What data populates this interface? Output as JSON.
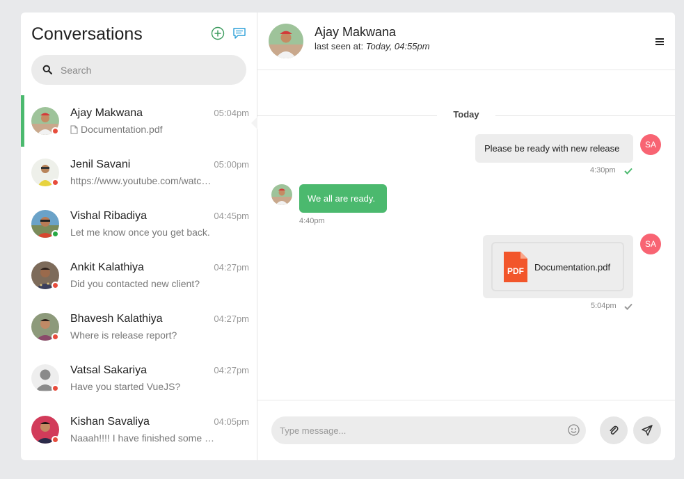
{
  "sidebar": {
    "title": "Conversations",
    "search_placeholder": "Search",
    "conversations": [
      {
        "name": "Ajay Makwana",
        "time": "05:04pm",
        "message": "Documentation.pdf",
        "status_color": "#e74c3c",
        "active": true
      },
      {
        "name": "Jenil Savani",
        "time": "05:00pm",
        "message": "https://www.youtube.com/watch?v=",
        "status_color": "#e74c3c"
      },
      {
        "name": "Vishal Ribadiya",
        "time": "04:45pm",
        "message": "Let me know once you get back.",
        "status_color": "#27a844"
      },
      {
        "name": "Ankit Kalathiya",
        "time": "04:27pm",
        "message": "Did you contacted new client?",
        "status_color": "#e74c3c"
      },
      {
        "name": "Bhavesh Kalathiya",
        "time": "04:27pm",
        "message": "Where is release report?",
        "status_color": "#e74c3c"
      },
      {
        "name": "Vatsal Sakariya",
        "time": "04:27pm",
        "message": "Have you started VueJS?",
        "status_color": "#e74c3c"
      },
      {
        "name": "Kishan Savaliya",
        "time": "04:05pm",
        "message": "Naaah!!!! I have finished some tasks",
        "status_color": "#e74c3c"
      }
    ]
  },
  "chat": {
    "name": "Ajay Makwana",
    "last_seen_label": "last seen at:",
    "last_seen_value": "Today, 04:55pm",
    "date_divider": "Today",
    "messages": [
      {
        "text": "Please be ready with new release",
        "time": "4:30pm",
        "sender_initials": "SA"
      },
      {
        "text": "We all are ready.",
        "time": "4:40pm"
      },
      {
        "file_name": "Documentation.pdf",
        "file_type": "PDF",
        "time": "5:04pm",
        "sender_initials": "SA"
      }
    ],
    "input_placeholder": "Type message..."
  },
  "colors": {
    "accent": "#4bb96e",
    "sa_avatar": "#f86473",
    "pdf": "#f2562b"
  }
}
